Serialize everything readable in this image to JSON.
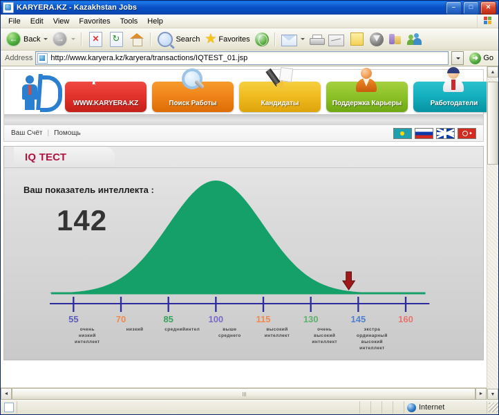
{
  "window": {
    "title": "KARYERA.KZ - Kazakhstan Jobs",
    "minimize": "–",
    "maximize": "□",
    "close": "✕"
  },
  "menu": {
    "items": [
      "File",
      "Edit",
      "View",
      "Favorites",
      "Tools",
      "Help"
    ]
  },
  "toolbar": {
    "back_label": "Back",
    "search_label": "Search",
    "favorites_label": "Favorites",
    "icons": [
      "back-arrow-icon",
      "forward-arrow-icon",
      "stop-icon",
      "refresh-icon",
      "home-icon",
      "search-icon",
      "favorites-star-icon",
      "media-icon",
      "mail-icon",
      "print-icon",
      "edit-icon",
      "notes-icon",
      "messenger-icon",
      "research-icon",
      "people-icon"
    ]
  },
  "address": {
    "label": "Address",
    "url": "http://www.karyera.kz/karyera/transactions/IQTEST_01.jsp",
    "go_label": "Go",
    "go_glyph": "➜"
  },
  "site": {
    "logo_alt": "karyera-k-logo",
    "nav": [
      {
        "label": "WWW.KARYERA.KZ",
        "color": "#e3342c",
        "icon": "info-icon"
      },
      {
        "label": "Поиск Работы",
        "color": "#f0851a",
        "icon": "magnifier-icon"
      },
      {
        "label": "Кандидаты",
        "color": "#f0bc22",
        "icon": "pen-icon"
      },
      {
        "label": "Поддержка Карьеры",
        "color": "#8dc229",
        "icon": "user-orange-icon"
      },
      {
        "label": "Работодатели",
        "color": "#14b0bf",
        "icon": "user-blue-icon"
      }
    ],
    "account_links": [
      "Ваш Счёт",
      "Помощь"
    ],
    "separator": "|",
    "flags": [
      "kazakhstan-flag",
      "russia-flag",
      "uk-flag",
      "turkey-flag"
    ]
  },
  "panel": {
    "tab_title": "IQ ТЕСТ",
    "question_label": "Ваш показатель интеллекта :",
    "score": "142",
    "marker_icon": "down-arrow-marker"
  },
  "chart_data": {
    "type": "area",
    "title": "IQ ТЕСТ",
    "xlabel": "",
    "ylabel": "",
    "curve": "normal-distribution-bell-curve",
    "curve_color": "#15a06a",
    "axis_color": "#2b2b9e",
    "mean": 100,
    "std": 15,
    "xlim": [
      47.5,
      167.5
    ],
    "marker_value": 142,
    "score": 142,
    "grid": false,
    "legend": null,
    "categories": [
      55,
      70,
      85,
      100,
      115,
      130,
      145,
      160
    ],
    "ticks": [
      {
        "value": "55",
        "color": "#5b5bc0",
        "desc": "очень\nнизкий\nинтеллект"
      },
      {
        "value": "70",
        "color": "#f0894a",
        "desc": "низкий"
      },
      {
        "value": "85",
        "color": "#35a35a",
        "desc": "среднийинтел"
      },
      {
        "value": "100",
        "color": "#7b6bc8",
        "desc": "выше\nсреднего"
      },
      {
        "value": "115",
        "color": "#f0894a",
        "desc": "высокий\nинтеллект"
      },
      {
        "value": "130",
        "color": "#5cb06a",
        "desc": "очень\nвысокий\nинтеллект"
      },
      {
        "value": "145",
        "color": "#4f7fd0",
        "desc": "экстра\nординарный\nвысокий\nинтеллект"
      },
      {
        "value": "160",
        "color": "#e8746e",
        "desc": ""
      }
    ]
  },
  "statusbar": {
    "zone": "Internet",
    "zone_icon": "internet-globe-icon",
    "doc_icon": "document-icon"
  },
  "scroll": {
    "up": "▲",
    "down": "▼",
    "left": "◄",
    "right": "►"
  }
}
